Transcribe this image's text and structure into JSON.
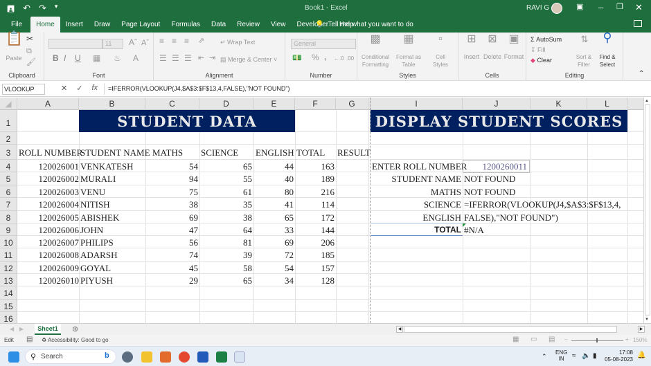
{
  "titlebar": {
    "title": "Book1  -  Excel",
    "user": "RAVI G",
    "qa_icons": [
      "save-icon",
      "undo-icon",
      "redo-icon",
      "customize-icon"
    ]
  },
  "tabs": [
    "File",
    "Home",
    "Insert",
    "Draw",
    "Page Layout",
    "Formulas",
    "Data",
    "Review",
    "View",
    "Developer",
    "Help"
  ],
  "active_tab": "Home",
  "tellme": "Tell me what you want to do",
  "ribbon": {
    "clipboard": {
      "label": "Clipboard",
      "paste": "Paste"
    },
    "font": {
      "label": "Font",
      "font_name": "",
      "font_size": "11",
      "bold": "B",
      "italic": "I",
      "underline": "U"
    },
    "alignment": {
      "label": "Alignment",
      "wrap_text": "Wrap Text",
      "merge_center": "Merge & Center"
    },
    "number": {
      "label": "Number",
      "format": "General",
      "percent": "%",
      "comma": ","
    },
    "styles": {
      "label": "Styles",
      "conditional": "Conditional Formatting",
      "format_table": "Format as Table",
      "cell_styles": "Cell Styles"
    },
    "cells": {
      "label": "Cells",
      "insert": "Insert",
      "delete": "Delete",
      "format": "Format"
    },
    "editing": {
      "label": "Editing",
      "autosum": "AutoSum",
      "fill": "Fill",
      "clear": "Clear",
      "sort_filter": "Sort & Filter",
      "find_select": "Find & Select"
    }
  },
  "formula_bar": {
    "name_box": "VLOOKUP",
    "formula": "=IFERROR(VLOOKUP(J4,$A$3:$F$13,4,FALSE),\"NOT FOUND\")"
  },
  "columns": [
    "A",
    "B",
    "C",
    "D",
    "E",
    "F",
    "G",
    "I",
    "J",
    "K",
    "L"
  ],
  "rows": [
    "1",
    "2",
    "3",
    "4",
    "5",
    "6",
    "7",
    "8",
    "9",
    "10",
    "11",
    "12",
    "13",
    "14",
    "15",
    "16"
  ],
  "student_data": {
    "title": "STUDENT DATA",
    "headers": [
      "ROLL NUMBER",
      "STUDENT NAME",
      "MATHS",
      "SCIENCE",
      "ENGLISH",
      "TOTAL",
      "RESULT"
    ],
    "records": [
      {
        "roll": "120026001",
        "name": "VENKATESH",
        "maths": "54",
        "science": "65",
        "english": "44",
        "total": "163"
      },
      {
        "roll": "120026002",
        "name": "MURALI",
        "maths": "94",
        "science": "55",
        "english": "40",
        "total": "189"
      },
      {
        "roll": "120026003",
        "name": "VENU",
        "maths": "75",
        "science": "61",
        "english": "80",
        "total": "216"
      },
      {
        "roll": "120026004",
        "name": "NITISH",
        "maths": "38",
        "science": "35",
        "english": "41",
        "total": "114"
      },
      {
        "roll": "120026005",
        "name": "ABISHEK",
        "maths": "69",
        "science": "38",
        "english": "65",
        "total": "172"
      },
      {
        "roll": "120026006",
        "name": "JOHN",
        "maths": "47",
        "science": "64",
        "english": "33",
        "total": "144"
      },
      {
        "roll": "120026007",
        "name": "PHILIPS",
        "maths": "56",
        "science": "81",
        "english": "69",
        "total": "206"
      },
      {
        "roll": "120026008",
        "name": "ADARSH",
        "maths": "74",
        "science": "39",
        "english": "72",
        "total": "185"
      },
      {
        "roll": "120026009",
        "name": "GOYAL",
        "maths": "45",
        "science": "58",
        "english": "54",
        "total": "157"
      },
      {
        "roll": "120026010",
        "name": "PIYUSH",
        "maths": "29",
        "science": "65",
        "english": "34",
        "total": "128"
      }
    ]
  },
  "display": {
    "title": "DISPLAY STUDENT SCORES",
    "enter_label": "ENTER ROLL NUMBER",
    "roll_value": "1200260011",
    "labels": [
      "STUDENT NAME",
      "MATHS",
      "SCIENCE",
      "ENGLISH",
      "TOTAL"
    ],
    "values": [
      "NOT FOUND",
      "NOT FOUND",
      "=IFERROR(VLOOKUP(J4,$A$3:$F$13,4,",
      "FALSE),\"NOT FOUND\")",
      "#N/A"
    ]
  },
  "sheet_tab": "Sheet1",
  "status": {
    "mode": "Edit",
    "accessibility": "Accessibility: Good to go",
    "zoom": "150%"
  },
  "taskbar": {
    "search": "Search",
    "lang1": "ENG",
    "lang2": "IN",
    "time": "17:08",
    "date": "05-08-2023"
  },
  "colors": {
    "excel_green": "#1e6e3e",
    "banner_navy": "#002060"
  }
}
